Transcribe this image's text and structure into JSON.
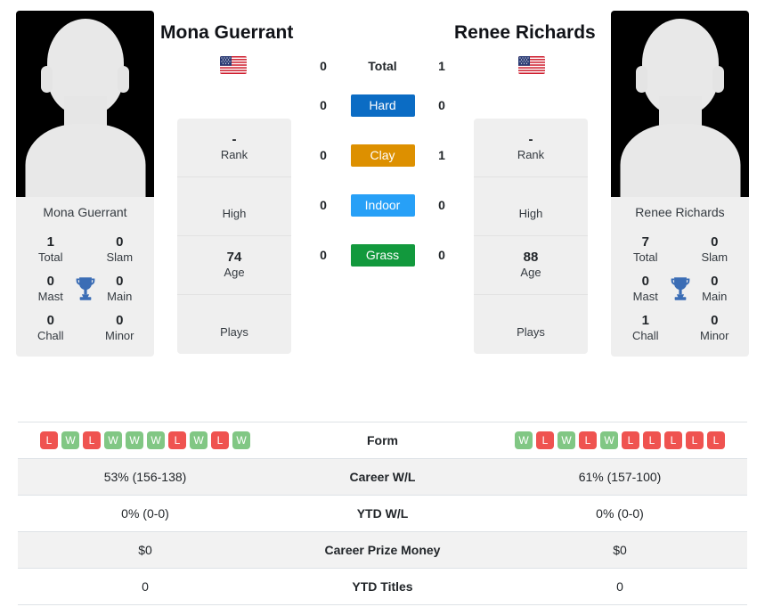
{
  "players": {
    "left": {
      "name": "Mona Guerrant",
      "card_name": "Mona Guerrant",
      "flag": "us-flag-icon",
      "avatar": "player-silhouette-icon",
      "titles": [
        {
          "value": "1",
          "label": "Total"
        },
        {
          "value": "0",
          "label": "Slam"
        },
        {
          "value": "0",
          "label": "Mast"
        },
        {
          "value": "0",
          "label": "Main"
        },
        {
          "value": "0",
          "label": "Chall"
        },
        {
          "value": "0",
          "label": "Minor"
        }
      ],
      "info": [
        {
          "value": "-",
          "label": "Rank"
        },
        {
          "value": "",
          "label": "High"
        },
        {
          "value": "74",
          "label": "Age"
        },
        {
          "value": "",
          "label": "Plays"
        }
      ],
      "form": [
        "L",
        "W",
        "L",
        "W",
        "W",
        "W",
        "L",
        "W",
        "L",
        "W"
      ],
      "career_wl": "53% (156-138)",
      "ytd_wl": "0% (0-0)",
      "career_prize_money": "$0",
      "ytd_titles": "0"
    },
    "right": {
      "name": "Renee Richards",
      "card_name": "Renee Richards",
      "flag": "us-flag-icon",
      "avatar": "player-silhouette-icon",
      "titles": [
        {
          "value": "7",
          "label": "Total"
        },
        {
          "value": "0",
          "label": "Slam"
        },
        {
          "value": "0",
          "label": "Mast"
        },
        {
          "value": "0",
          "label": "Main"
        },
        {
          "value": "1",
          "label": "Chall"
        },
        {
          "value": "0",
          "label": "Minor"
        }
      ],
      "info": [
        {
          "value": "-",
          "label": "Rank"
        },
        {
          "value": "",
          "label": "High"
        },
        {
          "value": "88",
          "label": "Age"
        },
        {
          "value": "",
          "label": "Plays"
        }
      ],
      "form": [
        "W",
        "L",
        "W",
        "L",
        "W",
        "L",
        "L",
        "L",
        "L",
        "L"
      ],
      "career_wl": "61% (157-100)",
      "ytd_wl": "0% (0-0)",
      "career_prize_money": "$0",
      "ytd_titles": "0"
    }
  },
  "trophy_icon": "trophy-icon",
  "trophy_color": "#3b6db5",
  "h2h": {
    "total": {
      "label": "Total",
      "left": "0",
      "right": "1"
    },
    "surfaces": [
      {
        "label": "Hard",
        "color": "#0b6cc4",
        "left": "0",
        "right": "0"
      },
      {
        "label": "Clay",
        "color": "#dd9000",
        "left": "0",
        "right": "1"
      },
      {
        "label": "Indoor",
        "color": "#27a0f7",
        "left": "0",
        "right": "0"
      },
      {
        "label": "Grass",
        "color": "#12993d",
        "left": "0",
        "right": "0"
      }
    ]
  },
  "table": {
    "rows": [
      {
        "label": "Form",
        "type": "form"
      },
      {
        "label": "Career W/L",
        "type": "text",
        "key": "career_wl"
      },
      {
        "label": "YTD W/L",
        "type": "text",
        "key": "ytd_wl"
      },
      {
        "label": "Career Prize Money",
        "type": "text",
        "key": "career_prize_money"
      },
      {
        "label": "YTD Titles",
        "type": "text",
        "key": "ytd_titles"
      }
    ]
  },
  "colors": {
    "win_badge": "#81c784",
    "loss_badge": "#ef5350",
    "card_bg": "#efefef",
    "row_alt_bg": "#f2f2f2"
  }
}
